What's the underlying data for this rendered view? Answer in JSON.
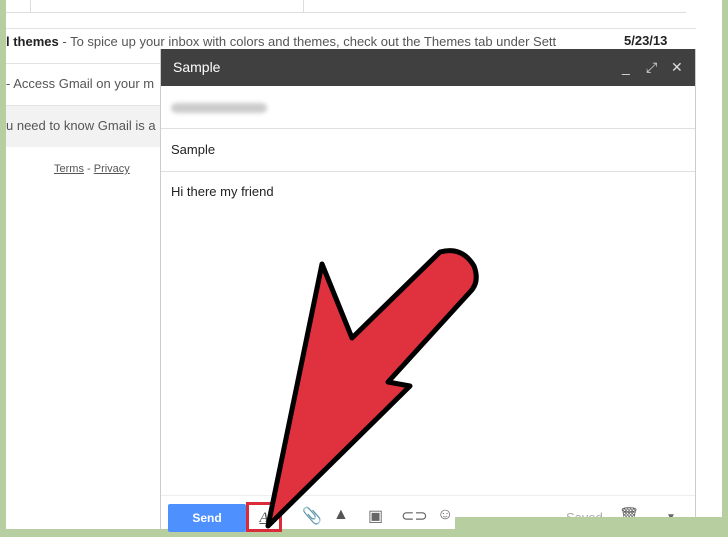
{
  "inbox": {
    "rows": [
      {
        "bold": "l themes",
        "text": " - To spice up your inbox with colors and themes, check out the Themes tab under Sett",
        "date": "5/23/13"
      },
      {
        "bold": "",
        "text": " - Access Gmail on your m"
      },
      {
        "bold": "",
        "text": "u need to know Gmail is a"
      }
    ],
    "footer": {
      "terms": "Terms",
      "sep": " - ",
      "privacy": "Privacy"
    }
  },
  "compose": {
    "title": "Sample",
    "minimize": "_",
    "expand": "⤢",
    "close": "✕",
    "subject": "Sample",
    "body": "Hi there my friend",
    "toolbar": {
      "send": "Send",
      "format": "A",
      "status": "Saved"
    }
  },
  "colors": {
    "frame": "#b7cfa0",
    "header": "#404040",
    "send": "#4d90fe",
    "arrow": "#e0313f",
    "highlight": "#d92b3a"
  }
}
